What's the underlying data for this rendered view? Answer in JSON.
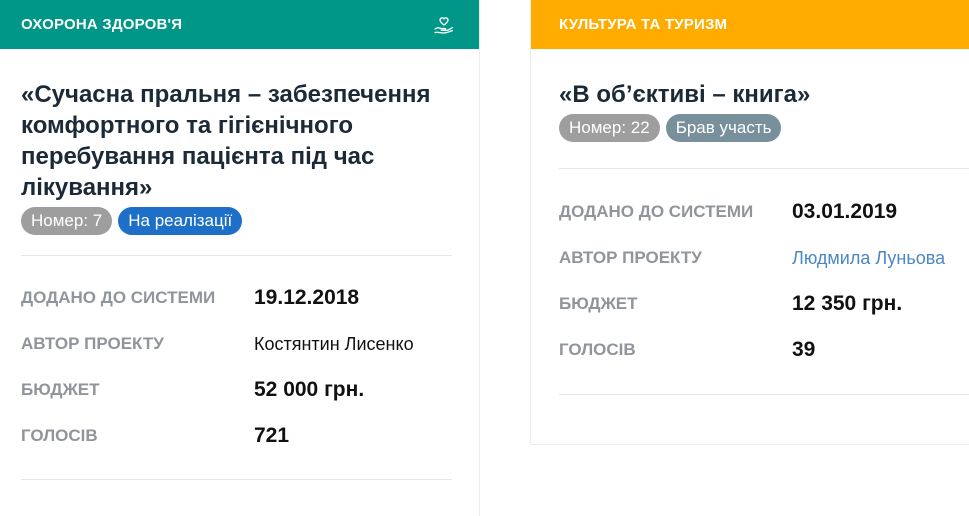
{
  "colors": {
    "health": "#009688",
    "culture": "#ffab00",
    "badge_grey": "#9e9e9e",
    "badge_blue": "#1e6fc8",
    "badge_dark_grey": "#78909c",
    "link": "#4a87c5"
  },
  "cards": [
    {
      "category": "ОХОРОНА ЗДОРОВ'Я",
      "category_icon": "hand-heart-icon",
      "title": "«Сучасна пральня – забезпечення комфортного та гігієнічного перебування пацієнта під час лікування»",
      "badges": [
        {
          "text": "Номер: 7",
          "color": "#9e9e9e"
        },
        {
          "text": "На реалізації",
          "color": "#1e6fc8"
        }
      ],
      "fields": [
        {
          "label": "ДОДАНО ДО СИСТЕМИ",
          "value": "19.12.2018"
        },
        {
          "label": "АВТОР ПРОЕКТУ",
          "value": "Костянтин Лисенко"
        },
        {
          "label": "БЮДЖЕТ",
          "value": "52 000 грн."
        },
        {
          "label": "ГОЛОСІВ",
          "value": "721"
        }
      ]
    },
    {
      "category": "КУЛЬТУРА ТА ТУРИЗМ",
      "title": "«В об’єктиві – книга»",
      "badges": [
        {
          "text": "Номер: 22",
          "color": "#9e9e9e"
        },
        {
          "text": "Брав участь",
          "color": "#78909c"
        }
      ],
      "fields": [
        {
          "label": "ДОДАНО ДО СИСТЕМИ",
          "value": "03.01.2019"
        },
        {
          "label": "АВТОР ПРОЕКТУ",
          "value": "Людмила Луньова"
        },
        {
          "label": "БЮДЖЕТ",
          "value": "12 350 грн."
        },
        {
          "label": "ГОЛОСІВ",
          "value": "39"
        }
      ]
    }
  ]
}
